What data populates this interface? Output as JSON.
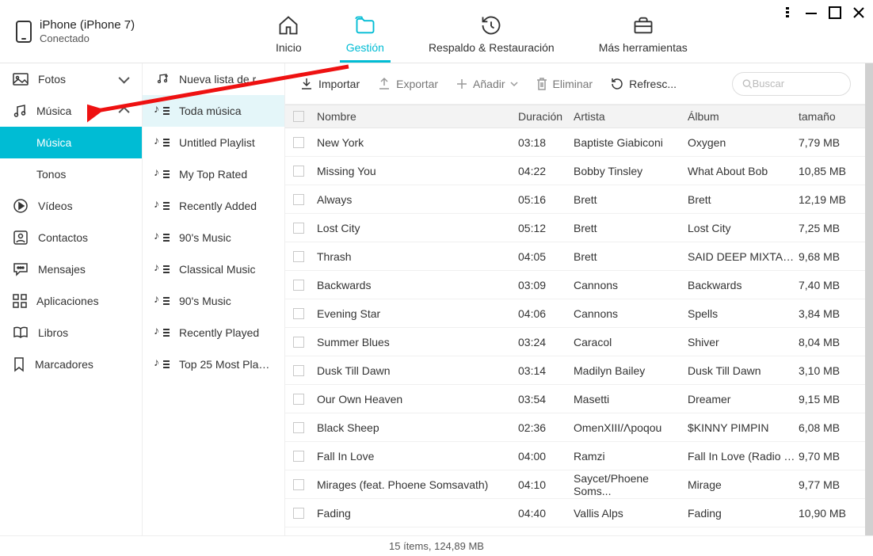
{
  "device": {
    "name": "iPhone (iPhone 7)",
    "status": "Conectado"
  },
  "tabs": {
    "inicio": "Inicio",
    "gestion": "Gestión",
    "respaldo": "Respaldo & Restauración",
    "herramientas": "Más herramientas"
  },
  "sidebar": {
    "fotos": "Fotos",
    "musica": "Música",
    "musica_sub": "Música",
    "tonos": "Tonos",
    "videos": "Vídeos",
    "contactos": "Contactos",
    "mensajes": "Mensajes",
    "aplicaciones": "Aplicaciones",
    "libros": "Libros",
    "marcadores": "Marcadores"
  },
  "playlists": [
    "Nueva lista de repro...",
    "Toda música",
    "Untitled Playlist",
    "My Top Rated",
    "Recently Added",
    "90's Music",
    "Classical Music",
    "90's Music",
    "Recently Played",
    "Top 25 Most Play..."
  ],
  "toolbar": {
    "importar": "Importar",
    "exportar": "Exportar",
    "anadir": "Añadir",
    "eliminar": "Eliminar",
    "refrescar": "Refresc...",
    "search_placeholder": "Buscar"
  },
  "columns": {
    "nombre": "Nombre",
    "duracion": "Duración",
    "artista": "Artista",
    "album": "Álbum",
    "tamano": "tamaño"
  },
  "songs": [
    {
      "nombre": "New York",
      "dur": "03:18",
      "art": "Baptiste Giabiconi",
      "alb": "Oxygen",
      "size": "7,79 MB"
    },
    {
      "nombre": "Missing You",
      "dur": "04:22",
      "art": "Bobby Tinsley",
      "alb": "What About Bob",
      "size": "10,85 MB"
    },
    {
      "nombre": "Always",
      "dur": "05:16",
      "art": "Brett",
      "alb": "Brett",
      "size": "12,19 MB"
    },
    {
      "nombre": "Lost City",
      "dur": "05:12",
      "art": "Brett",
      "alb": "Lost City",
      "size": "7,25 MB"
    },
    {
      "nombre": "Thrash",
      "dur": "04:05",
      "art": "Brett",
      "alb": "SAID DEEP MIXTAPE...",
      "size": "9,68 MB"
    },
    {
      "nombre": "Backwards",
      "dur": "03:09",
      "art": "Cannons",
      "alb": "Backwards",
      "size": "7,40 MB"
    },
    {
      "nombre": "Evening Star",
      "dur": "04:06",
      "art": "Cannons",
      "alb": "Spells",
      "size": "3,84 MB"
    },
    {
      "nombre": "Summer Blues",
      "dur": "03:24",
      "art": "Caracol",
      "alb": "Shiver",
      "size": "8,04 MB"
    },
    {
      "nombre": "Dusk Till Dawn",
      "dur": "03:14",
      "art": "Madilyn Bailey",
      "alb": "Dusk Till Dawn",
      "size": "3,10 MB"
    },
    {
      "nombre": "Our Own Heaven",
      "dur": "03:54",
      "art": "Masetti",
      "alb": "Dreamer",
      "size": "9,15 MB"
    },
    {
      "nombre": "Black Sheep",
      "dur": "02:36",
      "art": "OmenXIII/Λpoqou",
      "alb": "$KINNY PIMPIN",
      "size": "6,08 MB"
    },
    {
      "nombre": "Fall In Love",
      "dur": "04:00",
      "art": "Ramzi",
      "alb": "Fall In Love (Radio Ed...",
      "size": "9,70 MB"
    },
    {
      "nombre": "Mirages (feat. Phoene Somsavath)",
      "dur": "04:10",
      "art": "Saycet/Phoene Soms...",
      "alb": "Mirage",
      "size": "9,77 MB"
    },
    {
      "nombre": "Fading",
      "dur": "04:40",
      "art": "Vallis Alps",
      "alb": "Fading",
      "size": "10,90 MB"
    }
  ],
  "status": "15 ítems, 124,89 MB"
}
